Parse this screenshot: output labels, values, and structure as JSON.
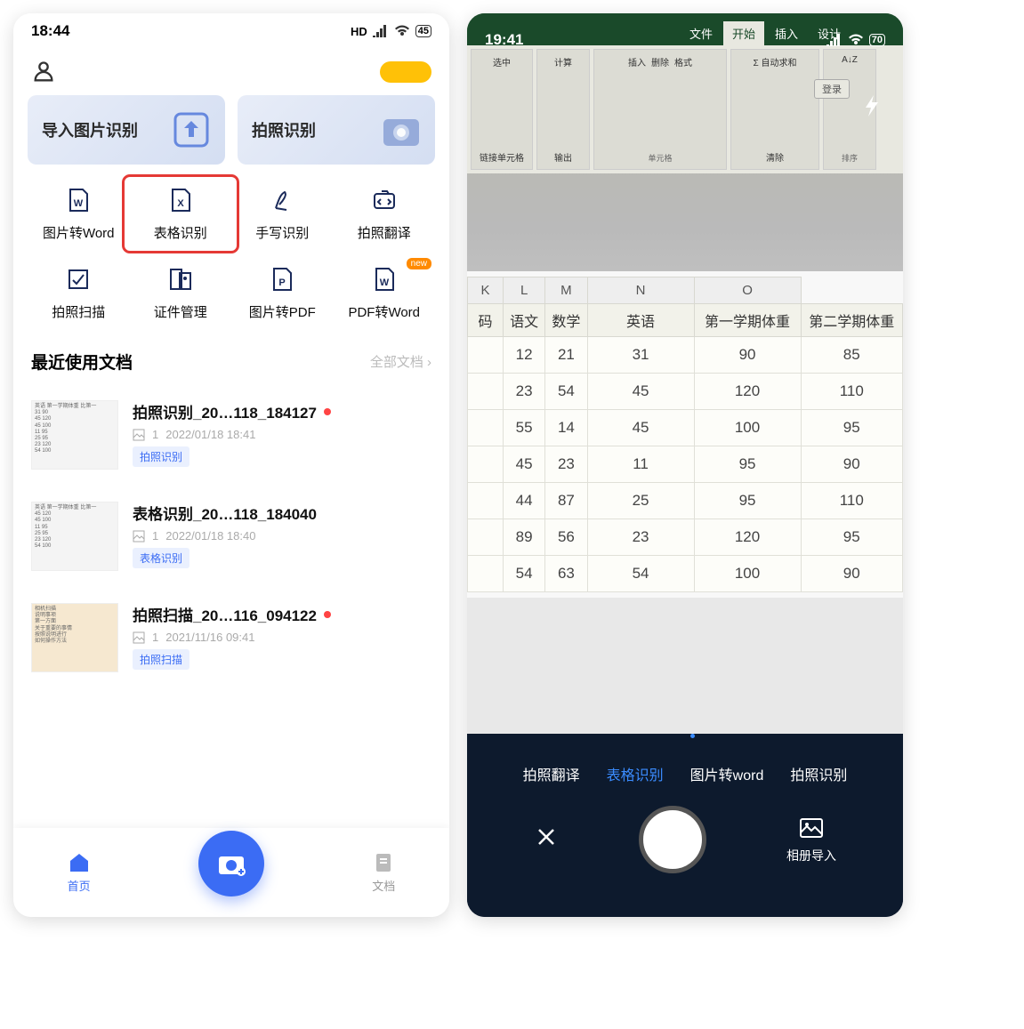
{
  "left": {
    "status": {
      "time": "18:44",
      "hd": "HD",
      "battery": "45"
    },
    "hero1": "导入图片识别",
    "hero2": "拍照识别",
    "tools": [
      {
        "label": "图片转Word",
        "icon": "word-icon"
      },
      {
        "label": "表格识别",
        "icon": "excel-icon",
        "highlighted": true
      },
      {
        "label": "手写识别",
        "icon": "handwrite-icon"
      },
      {
        "label": "拍照翻译",
        "icon": "translate-icon"
      },
      {
        "label": "拍照扫描",
        "icon": "scan-icon"
      },
      {
        "label": "证件管理",
        "icon": "idcard-icon"
      },
      {
        "label": "图片转PDF",
        "icon": "pdf-icon"
      },
      {
        "label": "PDF转Word",
        "icon": "pdf2word-icon",
        "badge": "new"
      }
    ],
    "recent": {
      "title": "最近使用文档",
      "more": "全部文档"
    },
    "docs": [
      {
        "title": "拍照识别_20…118_184127",
        "count": "1",
        "date": "2022/01/18 18:41",
        "tag": "拍照识别",
        "dot": true
      },
      {
        "title": "表格识别_20…118_184040",
        "count": "1",
        "date": "2022/01/18 18:40",
        "tag": "表格识别",
        "dot": false
      },
      {
        "title": "拍照扫描_20…116_094122",
        "count": "1",
        "date": "2021/11/16 09:41",
        "tag": "拍照扫描",
        "dot": true
      }
    ],
    "nav": {
      "home": "首页",
      "docs": "文档"
    }
  },
  "right": {
    "status": {
      "time": "19:41",
      "battery": "70"
    },
    "login": "登录",
    "ribbon_tabs": [
      "文件",
      "开始",
      "插入",
      "设计"
    ],
    "ribbon_groups": {
      "center": "选中",
      "calc": "计算",
      "link": "链接单元格",
      "input": "输出",
      "ins": "插入",
      "del": "删除",
      "fmt": "格式",
      "cell": "单元格",
      "sum": "自动求和",
      "clear": "清除",
      "sort": "排序"
    },
    "table": {
      "cols": [
        "K",
        "L",
        "M",
        "N",
        "O"
      ],
      "headers": [
        "码",
        "语文",
        "数学",
        "英语",
        "第一学期体重",
        "第二学期体重"
      ],
      "rows": [
        [
          "12",
          "21",
          "31",
          "90",
          "85"
        ],
        [
          "23",
          "54",
          "45",
          "120",
          "110"
        ],
        [
          "55",
          "14",
          "45",
          "100",
          "95"
        ],
        [
          "45",
          "23",
          "11",
          "95",
          "90"
        ],
        [
          "44",
          "87",
          "25",
          "95",
          "110"
        ],
        [
          "89",
          "56",
          "23",
          "120",
          "95"
        ],
        [
          "54",
          "63",
          "54",
          "100",
          "90"
        ]
      ]
    },
    "modes": [
      "拍照翻译",
      "表格识别",
      "图片转word",
      "拍照识别"
    ],
    "album": "相册导入"
  }
}
